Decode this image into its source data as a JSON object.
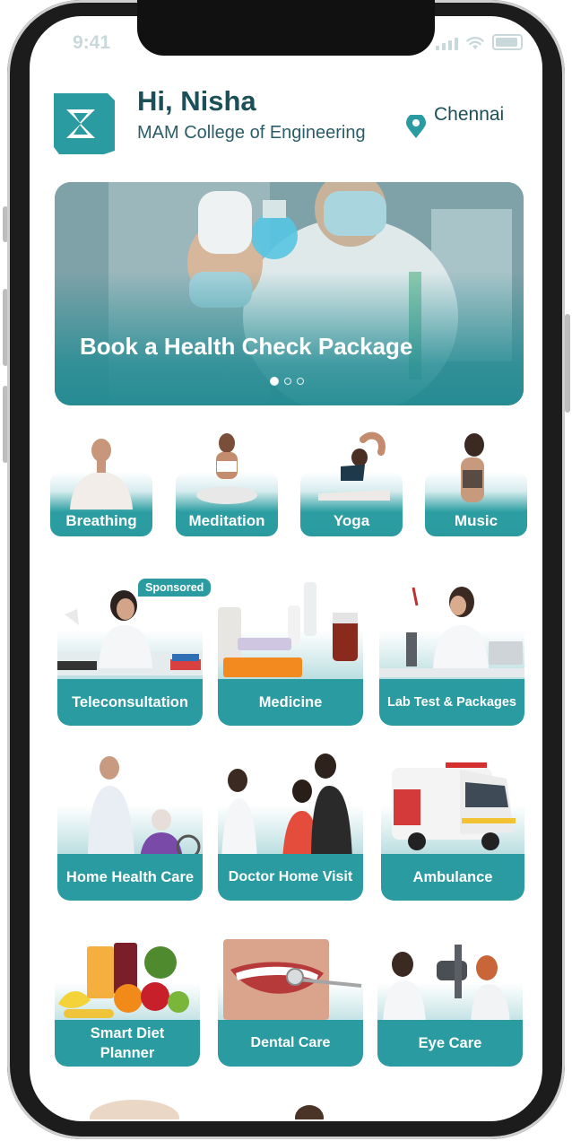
{
  "status": {
    "time": "9:41"
  },
  "header": {
    "greeting": "Hi, Nisha",
    "college": "MAM College of Engineering",
    "location": "Chennai"
  },
  "banner": {
    "title": "Book a Health Check Package",
    "slide_count": 3,
    "active_slide": 1
  },
  "wellness": [
    {
      "label": "Breathing"
    },
    {
      "label": "Meditation"
    },
    {
      "label": "Yoga"
    },
    {
      "label": "Music"
    }
  ],
  "services": [
    {
      "label": "Teleconsultation",
      "badge": "Sponsored"
    },
    {
      "label": "Medicine"
    },
    {
      "label": "Lab Test & Packages"
    },
    {
      "label": "Home Health Care"
    },
    {
      "label": "Doctor Home Visit"
    },
    {
      "label": "Ambulance"
    },
    {
      "label": "Smart Diet Planner"
    },
    {
      "label": "Dental Care"
    },
    {
      "label": "Eye Care"
    }
  ],
  "colors": {
    "accent": "#2a9ba0",
    "heading": "#1d4f59"
  }
}
